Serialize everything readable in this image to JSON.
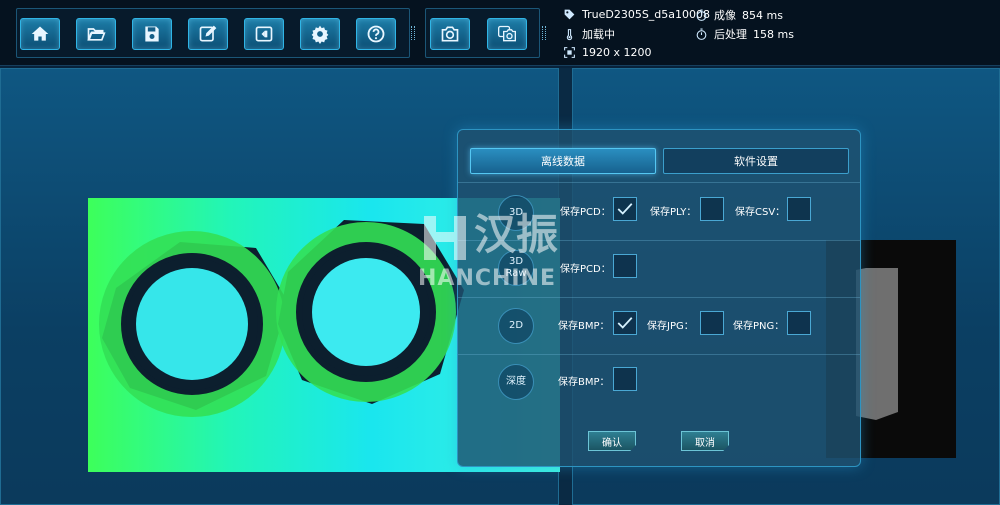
{
  "toolbar": {
    "buttons": [
      {
        "icon": "home-icon"
      },
      {
        "icon": "folder-open-icon"
      },
      {
        "icon": "save-icon"
      },
      {
        "icon": "edit-icon"
      },
      {
        "icon": "export-icon"
      },
      {
        "icon": "gear-icon"
      },
      {
        "icon": "help-icon"
      },
      {
        "icon": "camera-icon"
      },
      {
        "icon": "multi-camera-icon"
      }
    ]
  },
  "status": {
    "device_name": "TrueD2305S_d5a10008",
    "load_state": "加载中",
    "resolution": "1920 x 1200",
    "imaging_label": "成像",
    "imaging_value": "854 ms",
    "post_label": "后处理",
    "post_value": "158 ms"
  },
  "colors": {
    "accent": "#2fb5e6",
    "panel_bg": "#0f5782",
    "toolbar_bg": "#05121f"
  },
  "dialog": {
    "tabs": [
      {
        "label": "离线数据",
        "active": true
      },
      {
        "label": "软件设置",
        "active": false
      }
    ],
    "rows": [
      {
        "type": "3D",
        "options": [
          {
            "label": "保存PCD：",
            "checked": true
          },
          {
            "label": "保存PLY：",
            "checked": false
          },
          {
            "label": "保存CSV：",
            "checked": false
          }
        ]
      },
      {
        "type_line1": "3D",
        "type_line2": "Raw",
        "options": [
          {
            "label": "保存PCD：",
            "checked": false
          }
        ]
      },
      {
        "type": "2D",
        "options": [
          {
            "label": "保存BMP：",
            "checked": true
          },
          {
            "label": "保存JPG：",
            "checked": false
          },
          {
            "label": "保存PNG：",
            "checked": false
          }
        ]
      },
      {
        "type": "深度",
        "options": [
          {
            "label": "保存BMP：",
            "checked": false
          }
        ]
      }
    ],
    "confirm_label": "确认",
    "cancel_label": "取消"
  },
  "watermark": {
    "brand_cn": "汉振",
    "brand_en": "HANCHINE"
  }
}
